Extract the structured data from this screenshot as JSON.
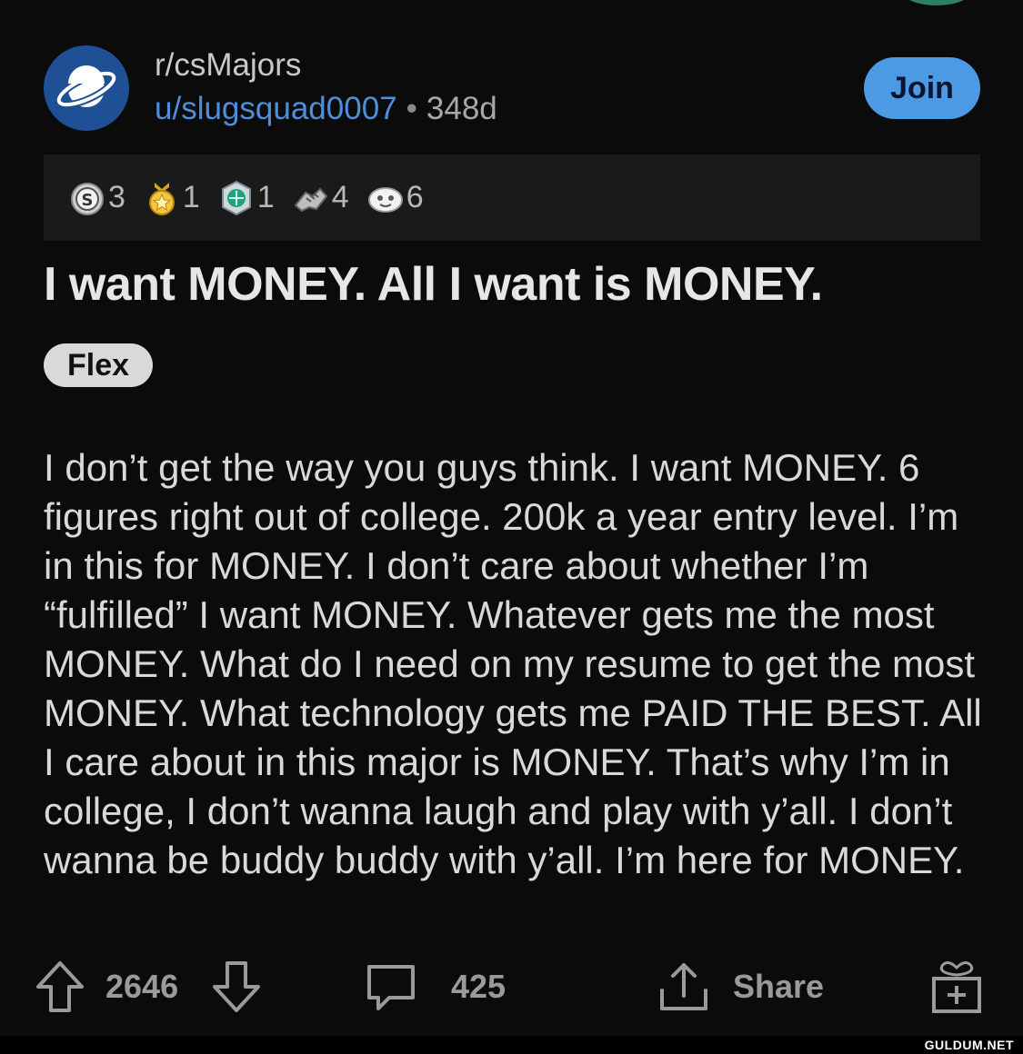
{
  "post": {
    "subreddit": "r/csMajors",
    "author": "u/slugsquad0007",
    "separator": "•",
    "age": "348d",
    "join_label": "Join",
    "title": "I want MONEY. All I want is MONEY.",
    "flair": "Flex",
    "body": "I don’t get the way you guys think. I want MONEY. 6 figures right out of college. 200k a year entry level. I’m in this for MONEY. I don’t care about whether I’m “fulfilled” I want MONEY. Whatever gets me the most MONEY. What do I need on my resume to get the most MONEY. What technology gets me PAID THE BEST. All I care about in this major is MONEY. That’s why I’m in college, I don’t wanna laugh and play with y’all. I don’t wanna be buddy buddy with y’all. I’m here for MONEY."
  },
  "awards": [
    {
      "icon": "silver-award-icon",
      "count": "3"
    },
    {
      "icon": "gold-award-icon",
      "count": "1"
    },
    {
      "icon": "platinum-award-icon",
      "count": "1"
    },
    {
      "icon": "handshake-award-icon",
      "count": "4"
    },
    {
      "icon": "helpful-award-icon",
      "count": "6"
    }
  ],
  "actions": {
    "score": "2646",
    "comments": "425",
    "share_label": "Share"
  },
  "watermark": "GULDUM.NET",
  "colors": {
    "background": "#0b0b0b",
    "join_button": "#4d9ae4",
    "username": "#4f8edb",
    "avatar": "#1f4f95"
  }
}
